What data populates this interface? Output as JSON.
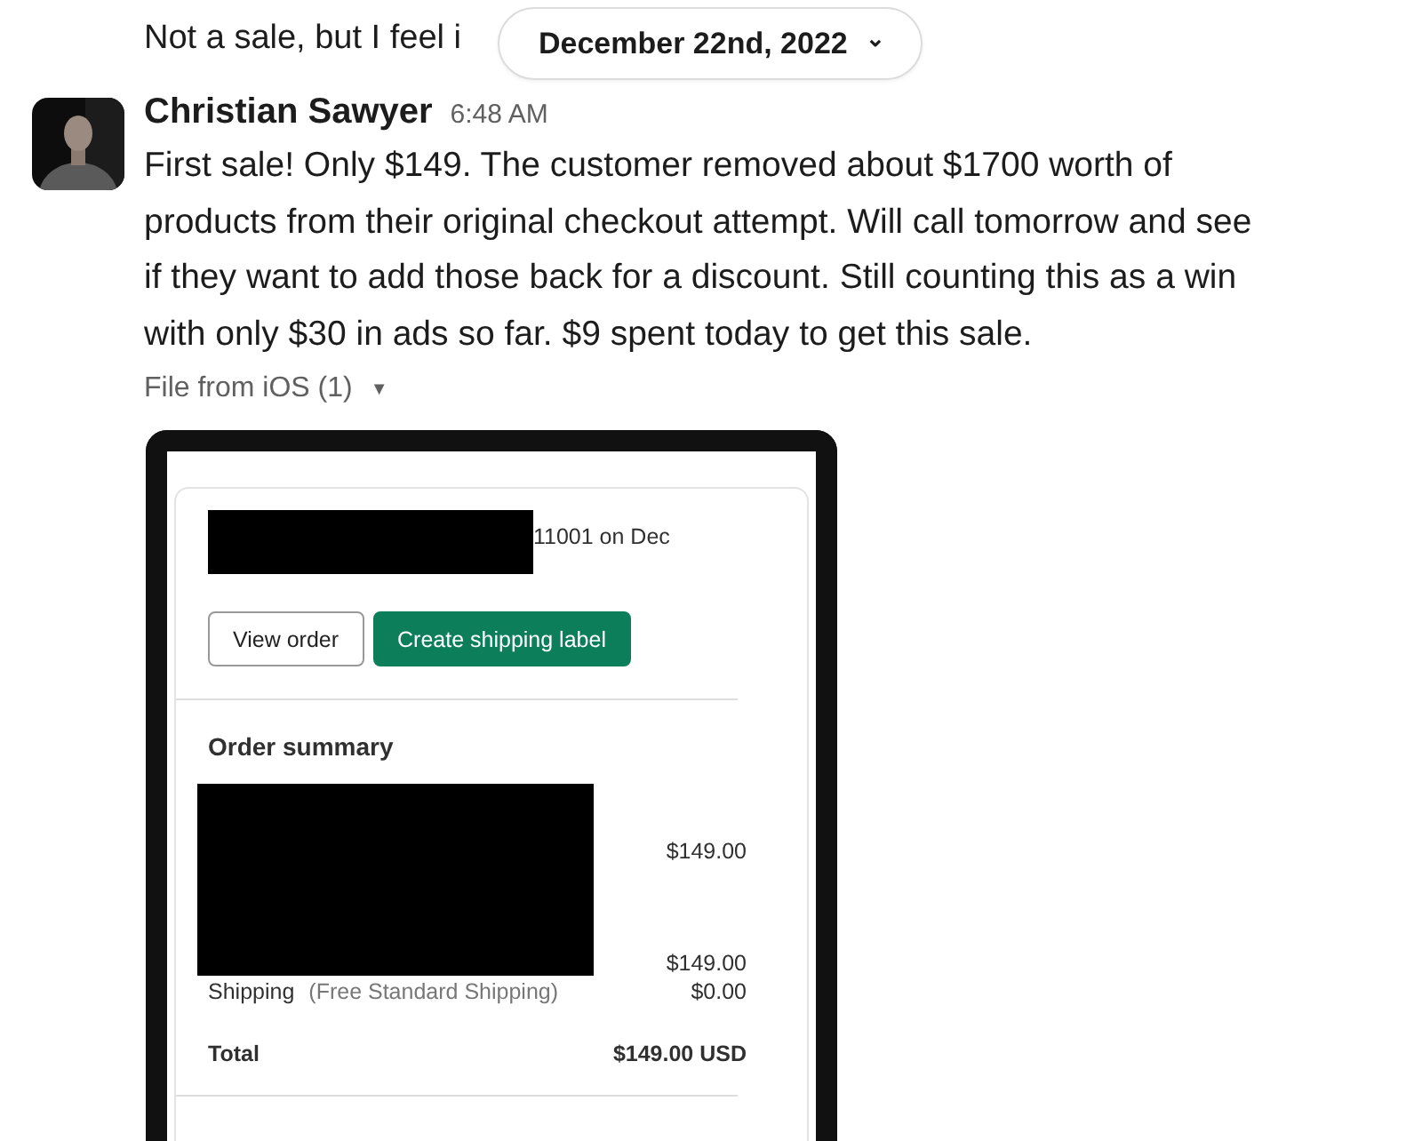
{
  "previous_message": {
    "text": "Not a sale, but I feel i"
  },
  "date_divider": {
    "label": "December 22nd, 2022",
    "caret": "⌄"
  },
  "message": {
    "author": "Christian Sawyer",
    "time": "6:48 AM",
    "lines": [
      "First sale! Only $149. The customer removed about $1700 worth of",
      "products from their original checkout attempt. Will call tomorrow and see",
      "if they want to add those back for a discount. Still counting this as a win",
      "with only $30 in ads so far. $9 spent today to get this sale."
    ],
    "attachment_label": "File from iOS (1)",
    "attachment_caret": "▼"
  },
  "screenshot": {
    "order_heading": "11001 on Dec",
    "buttons": [
      {
        "label": "View order",
        "kind": "secondary"
      },
      {
        "label": "Create shipping label",
        "kind": "primary"
      }
    ],
    "summary_title": "Order summary",
    "item_price": "$149.00",
    "subtotal": "$149.00",
    "shipping_label": "Shipping",
    "shipping_method": "(Free Standard Shipping)",
    "shipping_price": "$0.00",
    "total_label": "Total",
    "total": "$149.00 USD"
  }
}
